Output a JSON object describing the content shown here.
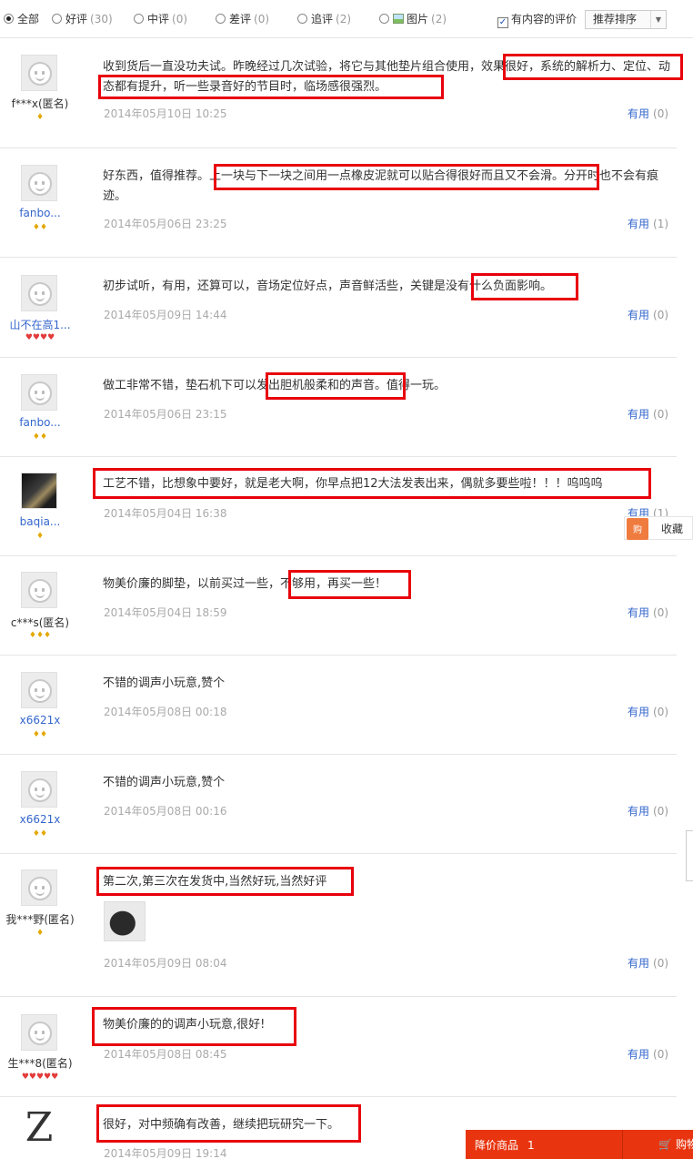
{
  "filter": {
    "options": [
      {
        "label": "全部",
        "count": ""
      },
      {
        "label": "好评",
        "count": "(30)"
      },
      {
        "label": "中评",
        "count": "(0)"
      },
      {
        "label": "差评",
        "count": "(0)"
      },
      {
        "label": "追评",
        "count": "(2)"
      },
      {
        "label": "图片",
        "count": "(2)"
      }
    ],
    "has_content_label": "有内容的评价",
    "sort_label": "推荐排序"
  },
  "useful_label": "有用",
  "reviews": [
    {
      "user": "f***x(匿名)",
      "badge": "♦",
      "text": "收到货后一直没功夫试。昨晚经过几次试验，将它与其他垫片组合使用，效果很好，系统的解析力、定位、动态都有提升，听一些录音好的节目时，临场感很强烈。",
      "date": "2014年05月10日 10:25",
      "useful": "(0)"
    },
    {
      "user": "fanbo...",
      "badge": "♦♦",
      "text": "好东西，值得推荐。上一块与下一块之间用一点橡皮泥就可以贴合得很好而且又不会滑。分开时也不会有痕迹。",
      "date": "2014年05月06日 23:25",
      "useful": "(1)"
    },
    {
      "user": "山不在高1...",
      "badge": "♥♥♥♥",
      "text": "初步试听，有用，还算可以，音场定位好点，声音鲜活些，关键是没有什么负面影响。",
      "date": "2014年05月09日 14:44",
      "useful": "(0)"
    },
    {
      "user": "fanbo...",
      "badge": "♦♦",
      "text": "做工非常不错，垫石机下可以发出胆机般柔和的声音。值得一玩。",
      "date": "2014年05月06日 23:15",
      "useful": "(0)"
    },
    {
      "user": "baqia...",
      "badge": "♦",
      "text": "工艺不错，比想象中要好，就是老大啊，你早点把12大法发表出来，偶就多要些啦！！！呜呜呜",
      "date": "2014年05月04日 16:38",
      "useful": "(1)"
    },
    {
      "user": "c***s(匿名)",
      "badge": "♦♦♦",
      "text": "物美价廉的脚垫，以前买过一些，不够用，再买一些！",
      "date": "2014年05月04日 18:59",
      "useful": "(0)"
    },
    {
      "user": "x6621x",
      "badge": "♦♦",
      "text": "不错的调声小玩意,赞个",
      "date": "2014年05月08日 00:18",
      "useful": "(0)"
    },
    {
      "user": "x6621x",
      "badge": "♦♦",
      "text": "不错的调声小玩意,赞个",
      "date": "2014年05月08日 00:16",
      "useful": "(0)"
    },
    {
      "user": "我***野(匿名)",
      "badge": "♦",
      "text": "第二次,第三次在发货中,当然好玩,当然好评",
      "date": "2014年05月09日 08:04",
      "useful": "(0)"
    },
    {
      "user": "生***8(匿名)",
      "badge": "♥♥♥♥♥",
      "text": "物美价廉的的调声小玩意,很好!",
      "date": "2014年05月08日 08:45",
      "useful": "(0)"
    },
    {
      "user": "",
      "avatar_letter": "Z",
      "badge": "",
      "text": "很好，对中频确有改善，继续把玩研究一下。",
      "date": "2014年05月09日 19:14",
      "useful": ""
    }
  ],
  "favorite_label": "收藏",
  "favorite_icon_text": "购",
  "price_bar": {
    "label": "降价商品",
    "count": "1",
    "cart_label": "购物"
  }
}
